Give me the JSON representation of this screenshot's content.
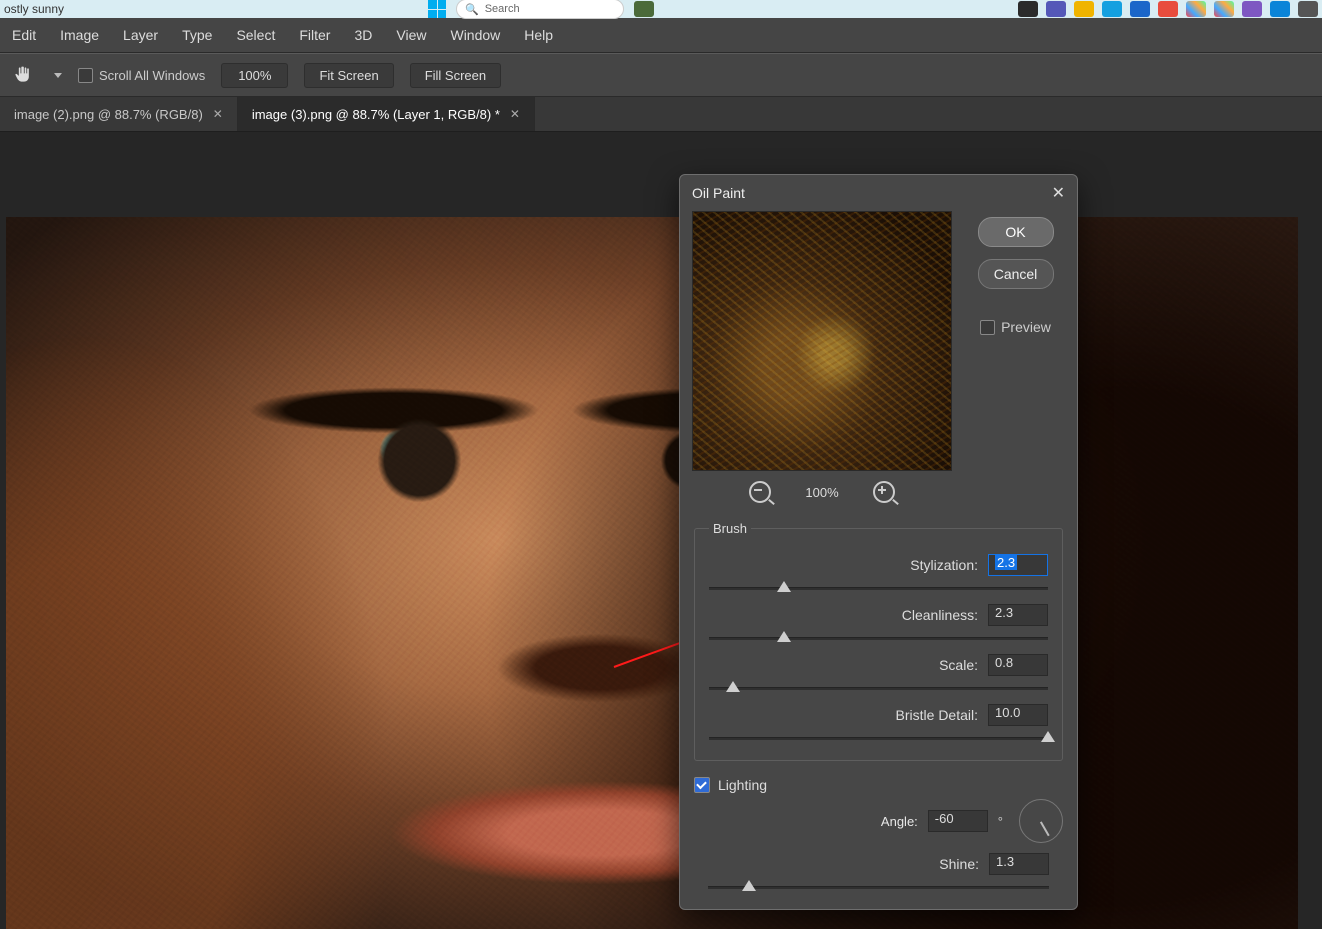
{
  "taskbar": {
    "weather": "ostly sunny",
    "search_placeholder": "Search"
  },
  "menubar": [
    "Edit",
    "Image",
    "Layer",
    "Type",
    "Select",
    "Filter",
    "3D",
    "View",
    "Window",
    "Help"
  ],
  "optbar": {
    "scroll_all": "Scroll All Windows",
    "zoom": "100%",
    "fit": "Fit Screen",
    "fill": "Fill Screen"
  },
  "tabs": [
    {
      "label": "image (2).png @ 88.7% (RGB/8)",
      "active": false
    },
    {
      "label": "image (3).png @ 88.7% (Layer 1, RGB/8) *",
      "active": true
    }
  ],
  "dialog": {
    "title": "Oil Paint",
    "ok": "OK",
    "cancel": "Cancel",
    "preview": "Preview",
    "zoom": "100%",
    "brush_legend": "Brush",
    "stylization_label": "Stylization:",
    "stylization_value": "2.3",
    "cleanliness_label": "Cleanliness:",
    "cleanliness_value": "2.3",
    "scale_label": "Scale:",
    "scale_value": "0.8",
    "bristle_label": "Bristle Detail:",
    "bristle_value": "10.0",
    "lighting_label": "Lighting",
    "angle_label": "Angle:",
    "angle_value": "-60",
    "shine_label": "Shine:",
    "shine_value": "1.3"
  },
  "slider_pos": {
    "stylization": "22%",
    "cleanliness": "22%",
    "scale": "7%",
    "bristle": "100%",
    "shine": "12%"
  }
}
